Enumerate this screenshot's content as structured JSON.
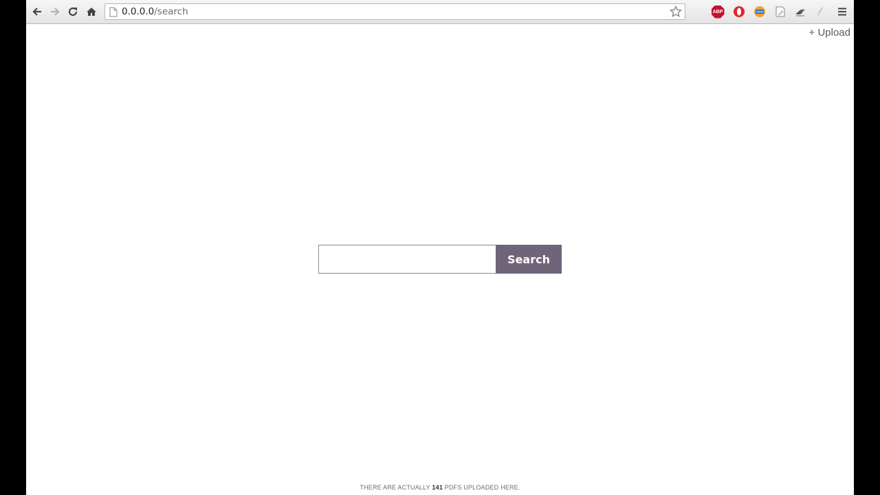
{
  "browser": {
    "url_host": "0.0.0.0",
    "url_path": "/search"
  },
  "header": {
    "upload_label": "+ Upload"
  },
  "search": {
    "button_label": "Search",
    "input_value": "",
    "placeholder": ""
  },
  "footer": {
    "prefix": "THERE ARE ACTUALLY",
    "count": "141",
    "suffix": "PDFS UPLOADED HERE."
  },
  "extensions": {
    "abp_label": "ABP",
    "icons": [
      "adblock-plus-icon",
      "opera-icon",
      "text-extension-icon",
      "notes-icon",
      "bird-icon",
      "feather-icon",
      "menu-icon"
    ]
  },
  "colors": {
    "search_button": "#6f6478",
    "abp": "#c8102e"
  }
}
